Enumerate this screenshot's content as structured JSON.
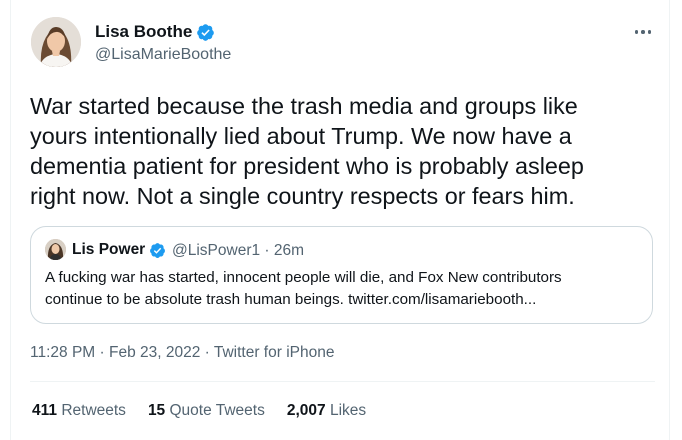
{
  "colors": {
    "verified_blue": "#1d9bf0",
    "text_primary": "#0f1419",
    "text_secondary": "#536471",
    "border": "#cfd9de"
  },
  "tweet": {
    "author": {
      "name": "Lisa Boothe",
      "handle": "@LisaMarieBoothe",
      "verified_icon": "verified-badge-icon",
      "avatar_icon": "profile-photo"
    },
    "menu_icon": "more-horizontal-icon",
    "text_lines": [
      "War started because the trash media and groups like",
      "yours intentionally lied about Trump. We now have a",
      "dementia patient for president who is probably asleep",
      "right now. Not a single country respects or fears him."
    ],
    "quote": {
      "author_name": "Lis Power",
      "handle_time": "@LisPower1 · 26m",
      "text_lines": [
        "A fucking war has started, innocent people will die, and Fox New contributors",
        "continue to be absolute trash human beings. twitter.com/lisamariebooth..."
      ]
    },
    "timestamp": {
      "time": "11:28 PM",
      "separator1": " · ",
      "date": "Feb 23, 2022",
      "separator2": " · ",
      "source": "Twitter for iPhone"
    },
    "stats": {
      "retweets_count": "411",
      "retweets_label": " Retweets",
      "quotes_count": "15",
      "quotes_label": " Quote Tweets",
      "likes_count": "2,007",
      "likes_label": " Likes"
    }
  }
}
